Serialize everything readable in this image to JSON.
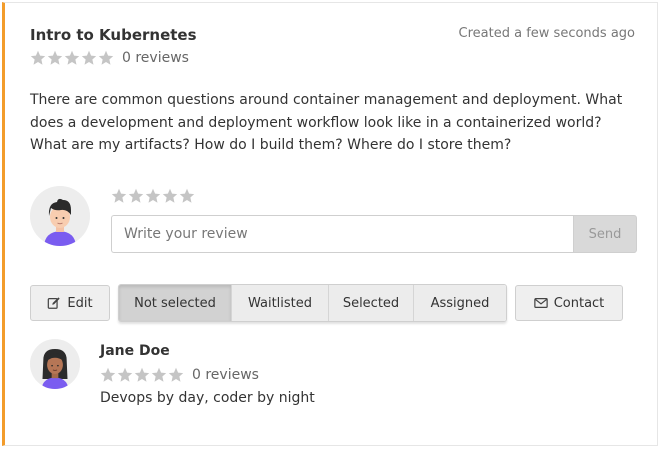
{
  "course": {
    "title": "Intro to Kubernetes",
    "created": "Created a few seconds ago",
    "rating": 0,
    "reviews_label": "0 reviews",
    "description": "There are common questions around container management and deployment. What does a development and deployment workflow look like in a containerized world? What are my artifacts? How do I build them? Where do I store them?"
  },
  "review_form": {
    "rating": 0,
    "placeholder": "Write your review",
    "send_label": "Send"
  },
  "actions": {
    "edit_label": "Edit",
    "contact_label": "Contact",
    "status_options": [
      "Not selected",
      "Waitlisted",
      "Selected",
      "Assigned"
    ],
    "status_selected": "Not selected"
  },
  "author": {
    "name": "Jane Doe",
    "rating": 0,
    "reviews_label": "0 reviews",
    "bio": "Devops by day, coder by night"
  },
  "colors": {
    "accent": "#f39c2b",
    "star_empty": "#c5c5c5"
  },
  "icons": {
    "edit": "edit-icon",
    "contact": "envelope-icon"
  }
}
